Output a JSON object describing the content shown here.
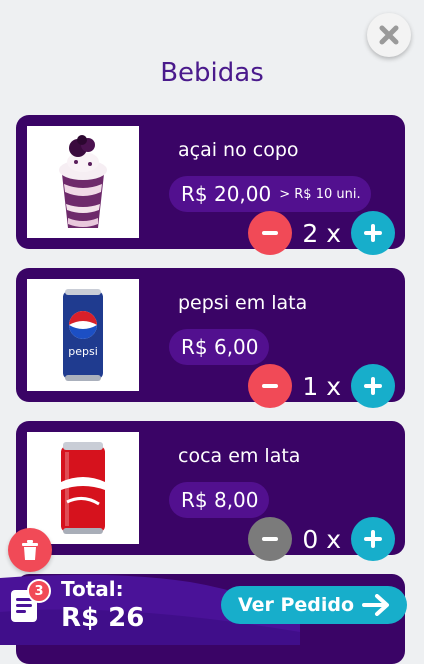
{
  "header": {
    "title": "Bebidas",
    "close_icon": "close-icon"
  },
  "products": [
    {
      "name": "açai no copo",
      "price": "R$ 20,00",
      "promo": "> R$ 10 uni.",
      "quantity_text": "2 x",
      "minus_state": "active"
    },
    {
      "name": "pepsi em lata",
      "price": "R$ 6,00",
      "promo": "",
      "quantity_text": "1 x",
      "minus_state": "active"
    },
    {
      "name": "coca em lata",
      "price": "R$ 8,00",
      "promo": "",
      "quantity_text": "0 x",
      "minus_state": "disabled"
    }
  ],
  "footer": {
    "badge_count": "3",
    "total_label": "Total:",
    "total_value": "R$ 26",
    "ver_pedido_label": "Ver Pedido"
  },
  "colors": {
    "card": "#3a0466",
    "accent_red": "#f14a57",
    "accent_teal": "#17aecb",
    "title": "#4a1a8c"
  }
}
